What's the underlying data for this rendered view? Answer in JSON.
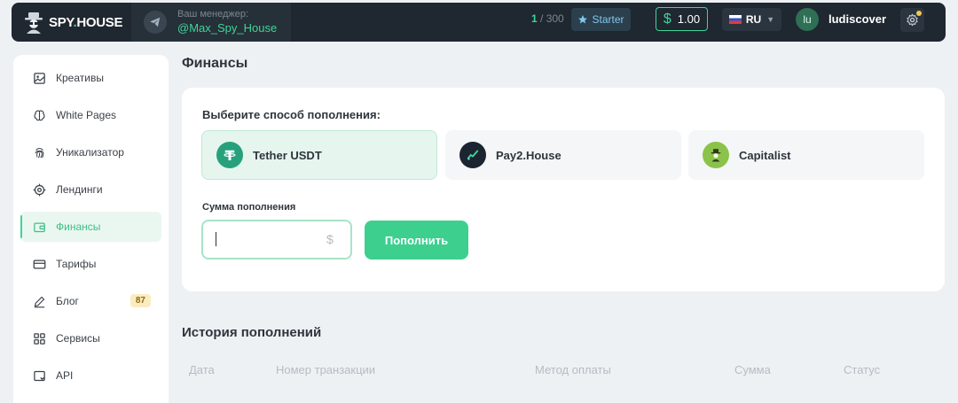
{
  "header": {
    "logo": {
      "text_main": "SPY",
      "text_dot": ".",
      "text_end": "HOUSE"
    },
    "manager_label": "Ваш менеджер:",
    "manager_name": "@Max_Spy_House",
    "quota_used": "1",
    "quota_total": "/ 300",
    "plan": "Starter",
    "balance_currency": "$",
    "balance": "1.00",
    "language": "RU",
    "avatar_initials": "lu",
    "username": "ludiscover"
  },
  "sidebar": {
    "items": [
      {
        "label": "Креативы",
        "icon": "image-icon"
      },
      {
        "label": "White Pages",
        "icon": "brain-icon"
      },
      {
        "label": "Уникализатор",
        "icon": "fingerprint-icon"
      },
      {
        "label": "Лендинги",
        "icon": "target-icon"
      },
      {
        "label": "Финансы",
        "icon": "wallet-icon",
        "active": true
      },
      {
        "label": "Тарифы",
        "icon": "card-icon"
      },
      {
        "label": "Блог",
        "icon": "pen-icon",
        "badge": "87"
      },
      {
        "label": "Сервисы",
        "icon": "grid-icon"
      },
      {
        "label": "API",
        "icon": "api-icon"
      }
    ]
  },
  "main": {
    "title": "Финансы",
    "method_prompt": "Выберите способ пополнения:",
    "methods": [
      {
        "name": "Tether USDT",
        "icon": "tether-icon",
        "selected": true
      },
      {
        "name": "Pay2.House",
        "icon": "pay2house-icon"
      },
      {
        "name": "Capitalist",
        "icon": "capitalist-icon"
      }
    ],
    "amount_label": "Сумма пополнения",
    "amount_value": "",
    "amount_currency": "$",
    "submit_label": "Пополнить",
    "history_title": "История пополнений",
    "history_columns": [
      "Дата",
      "Номер транзакции",
      "Метод оплаты",
      "Сумма",
      "Статус"
    ]
  },
  "colors": {
    "accent": "#3dd598",
    "topbar": "#1f2730",
    "background": "#eef1f4"
  }
}
